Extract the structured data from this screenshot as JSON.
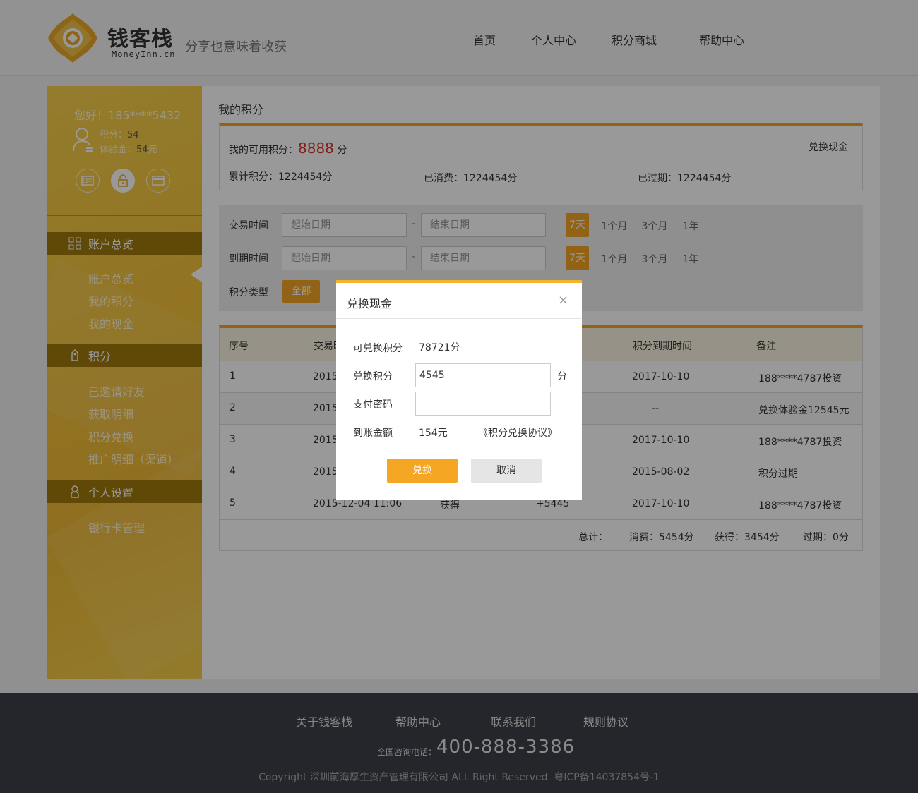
{
  "header": {
    "brand_name": "钱客栈",
    "brand_domain": "MoneyInn.cn",
    "slogan": "分享也意味着收获",
    "nav": [
      "首页",
      "个人中心",
      "积分商城",
      "帮助中心"
    ]
  },
  "sidebar": {
    "greeting": "您好！185****5432",
    "points_label": "积分：",
    "points_value": "54",
    "trial_label": "体验金：",
    "trial_value": "54",
    "trial_unit": "元",
    "sections": [
      {
        "title": "账户总览",
        "icon": "grid-icon",
        "items": [
          "账户总览",
          "我的积分",
          "我的现金"
        ]
      },
      {
        "title": "积分",
        "icon": "tag-icon",
        "items": [
          "已邀请好友",
          "获取明细",
          "积分兑换",
          "推广明细（渠道）"
        ]
      },
      {
        "title": "个人设置",
        "icon": "person-icon",
        "items": [
          "银行卡管理"
        ]
      }
    ]
  },
  "main": {
    "title": "我的积分",
    "summary": {
      "available_label": "我的可用积分：",
      "available_value": "8888",
      "available_unit": "分",
      "exchange_link": "兑换现金",
      "total": "累计积分：1224454分",
      "consumed": "已消费：1224454分",
      "expired": "已过期：1224454分"
    },
    "filters": {
      "trade_time_label": "交易时间",
      "expire_time_label": "到期时间",
      "type_label": "积分类型",
      "start_placeholder": "起始日期",
      "end_placeholder": "结束日期",
      "dash": "-",
      "ranges": [
        "7天",
        "1个月",
        "3个月",
        "1年"
      ],
      "type_all": "全部"
    },
    "table": {
      "headers": [
        "序号",
        "交易时间",
        "积分到期时间",
        "备注"
      ],
      "rows": [
        {
          "no": "1",
          "time": "2015",
          "type": "",
          "amount": "",
          "expire": "2017-10-10",
          "note": "188****4787投资"
        },
        {
          "no": "2",
          "time": "2015",
          "type": "",
          "amount": "",
          "expire": "--",
          "note": "兑换体验金12545元"
        },
        {
          "no": "3",
          "time": "2015",
          "type": "",
          "amount": "",
          "expire": "2017-10-10",
          "note": "188****4787投资"
        },
        {
          "no": "4",
          "time": "2015",
          "type": "",
          "amount": "",
          "expire": "2015-08-02",
          "note": "积分过期"
        },
        {
          "no": "5",
          "time": "2015-12-04  11:06",
          "type": "获得",
          "amount": "+5445",
          "expire": "2017-10-10",
          "note": "188****4787投资"
        }
      ],
      "totals": {
        "label": "总计：",
        "consumed": "消费：5454分",
        "gained": "获得：3454分",
        "expired": "过期：0分"
      }
    }
  },
  "modal": {
    "title": "兑换现金",
    "close": "×",
    "available_label": "可兑换积分",
    "available_value": "78721分",
    "exchange_label": "兑换积分",
    "exchange_value": "4545",
    "exchange_unit": "分",
    "password_label": "支付密码",
    "password_value": "",
    "amount_label": "到账金额",
    "amount_value": "154元",
    "agreement_link": "《积分兑换协议》",
    "confirm": "兑换",
    "cancel": "取消"
  },
  "footer": {
    "links": [
      "关于钱客栈",
      "帮助中心",
      "联系我们",
      "规则协议"
    ],
    "hotline_label": "全国咨询电话：",
    "hotline": "400-888-3386",
    "copyright": "Copyright  深圳前海厚生资产管理有限公司  ALL Right Reserved. 粤ICP备14037854号-1"
  },
  "colors": {
    "accent": "#f5a623",
    "sidebar": "#f3c23b",
    "sidebar_header": "#a0780d",
    "footer": "#3d404a",
    "link": "#1a8cd8",
    "highlight": "#d9342b"
  }
}
